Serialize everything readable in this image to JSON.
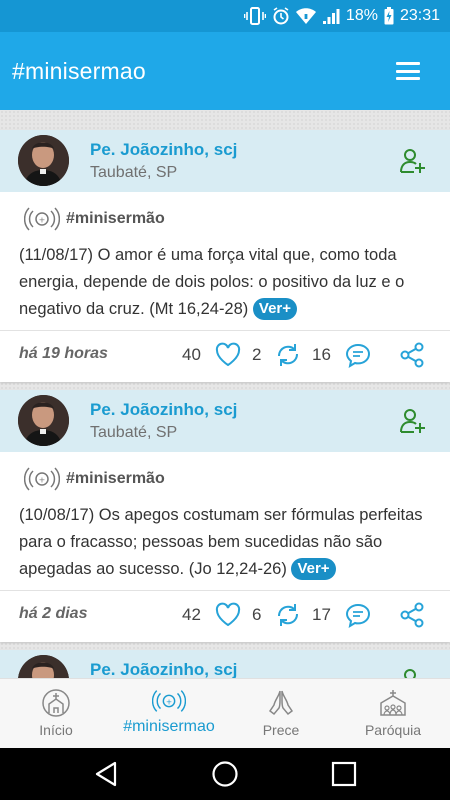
{
  "status_bar": {
    "battery": "18%",
    "time": "23:31"
  },
  "header": {
    "title": "#minisermao"
  },
  "posts": [
    {
      "author": "Pe. Joãozinho, scj",
      "city": "Taubaté, SP",
      "tag": "#minisermão",
      "text": "(11/08/17) O amor é uma força vital que, como toda energia, depende de dois polos: o positivo da luz e o negativo da cruz. (Mt 16,24-28)",
      "more": "Ver+",
      "time": "há 19 horas",
      "likes": "40",
      "shares": "2",
      "comments": "16"
    },
    {
      "author": "Pe. Joãozinho, scj",
      "city": "Taubaté, SP",
      "tag": "#minisermão",
      "text": "(10/08/17) Os apegos costumam ser fórmulas perfeitas para o fracasso; pessoas bem sucedidas não são apegadas ao sucesso. (Jo 12,24-26)",
      "more": "Ver+",
      "time": "há 2 dias",
      "likes": "42",
      "shares": "6",
      "comments": "17"
    },
    {
      "author": "Pe. Joãozinho, scj"
    }
  ],
  "bottom_nav": [
    {
      "label": "Início",
      "icon": "church-icon"
    },
    {
      "label": "#minisermao",
      "icon": "broadcast-icon",
      "active": true
    },
    {
      "label": "Prece",
      "icon": "praying-hands-icon"
    },
    {
      "label": "Paróquia",
      "icon": "parish-icon"
    }
  ],
  "colors": {
    "primary": "#1fa8e8",
    "status_bar": "#1596d3",
    "accent": "#1a9bd0",
    "card_header": "#d8ecf3",
    "follow_icon": "#2e8b2e"
  }
}
